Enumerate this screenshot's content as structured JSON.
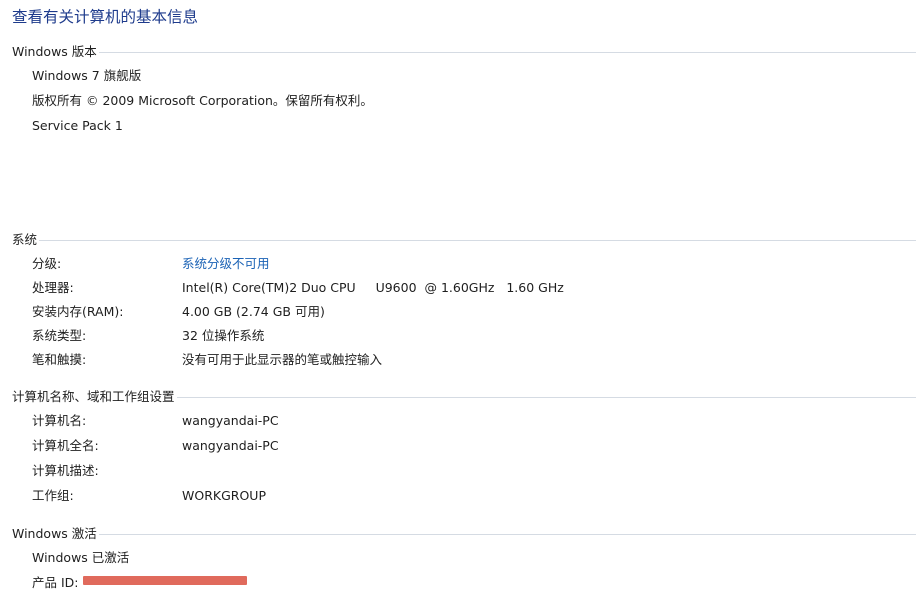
{
  "page_title": "查看有关计算机的基本信息",
  "windows_edition": {
    "title": "Windows 版本",
    "edition": "Windows 7 旗舰版",
    "copyright": "版权所有 © 2009 Microsoft Corporation。保留所有权利。",
    "service_pack": "Service Pack 1"
  },
  "system": {
    "title": "系统",
    "rows": [
      {
        "label": "分级:",
        "value": "系统分级不可用"
      },
      {
        "label": "处理器:",
        "value": "Intel(R) Core(TM)2 Duo CPU     U9600  @ 1.60GHz   1.60 GHz"
      },
      {
        "label": "安装内存(RAM):",
        "value": "4.00 GB (2.74 GB 可用)"
      },
      {
        "label": "系统类型:",
        "value": "32 位操作系统"
      },
      {
        "label": "笔和触摸:",
        "value": "没有可用于此显示器的笔或触控输入"
      }
    ]
  },
  "computer_name": {
    "title": "计算机名称、域和工作组设置",
    "rows": [
      {
        "label": "计算机名:",
        "value": "wangyandai-PC"
      },
      {
        "label": "计算机全名:",
        "value": "wangyandai-PC"
      },
      {
        "label": "计算机描述:",
        "value": ""
      },
      {
        "label": "工作组:",
        "value": "WORKGROUP"
      }
    ]
  },
  "activation": {
    "title": "Windows 激活",
    "status": "Windows 已激活",
    "product_id_label": "产品 ID:"
  }
}
